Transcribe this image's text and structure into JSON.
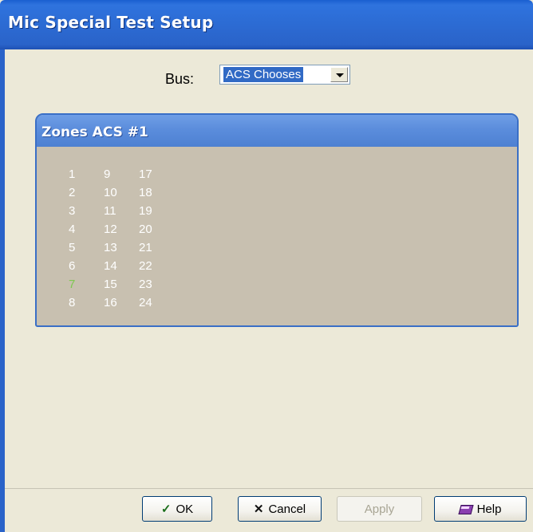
{
  "window": {
    "title": "Mic Special Test Setup"
  },
  "bus": {
    "label": "Bus:",
    "selected": "ACS Chooses"
  },
  "zones": {
    "header": "Zones ACS #1",
    "columns": [
      [
        "1",
        "2",
        "3",
        "4",
        "5",
        "6",
        "7",
        "8"
      ],
      [
        "9",
        "10",
        "11",
        "12",
        "13",
        "14",
        "15",
        "16"
      ],
      [
        "17",
        "18",
        "19",
        "20",
        "21",
        "22",
        "23",
        "24"
      ]
    ],
    "active_zone": "7",
    "colors": {
      "normal": "#ffffff",
      "active": "#7ec850",
      "panel_bg": "#c8c0b0"
    }
  },
  "buttons": {
    "ok": "OK",
    "cancel": "Cancel",
    "apply": "Apply",
    "help": "Help"
  }
}
